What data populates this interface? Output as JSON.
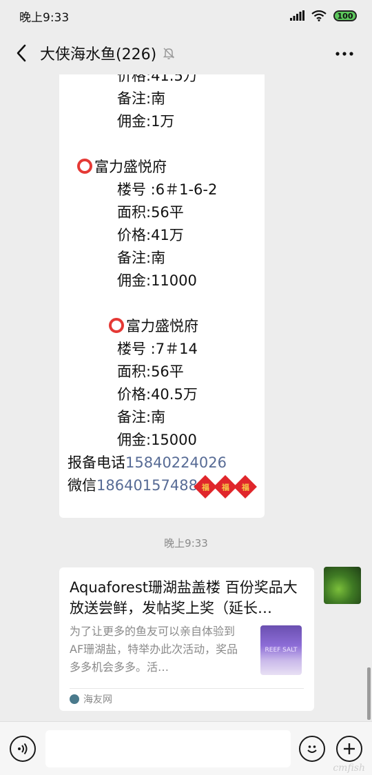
{
  "status_bar": {
    "time": "晚上9:33",
    "battery": "100"
  },
  "header": {
    "title": "大侠海水鱼(226)"
  },
  "message1": {
    "lines": {
      "a_price": "价格:41.5万",
      "a_note": "备注:南",
      "a_commission": "佣金:1万",
      "b_project": "富力盛悦府",
      "b_unit": "楼号 :6＃1-6-2",
      "b_area": "面积:56平",
      "b_price": "价格:41万",
      "b_note": "备注:南",
      "b_commission": "佣金:11000",
      "c_project": "富力盛悦府",
      "c_unit": "楼号 :7＃14",
      "c_area": "面积:56平",
      "c_price": "价格:40.5万",
      "c_note": "备注:南",
      "c_commission": "佣金:15000",
      "phone_label": "报备电话",
      "phone_number": "15840224026",
      "wechat_label": "微信",
      "wechat_number": "18640157488"
    },
    "emoji_glyph": "福"
  },
  "time_divider": "晚上9:33",
  "link_card": {
    "title": "Aquaforest珊湖盐盖楼 百份奖品大放送尝鲜，发帖奖上奖（延长…",
    "description": "为了让更多的鱼友可以亲自体验到AF珊湖盐，特举办此次活动，奖品多多机会多多。活…",
    "thumb_text": "REEF SALT",
    "source": "海友网"
  },
  "input_bar": {
    "placeholder": ""
  },
  "watermark": "cmfish"
}
